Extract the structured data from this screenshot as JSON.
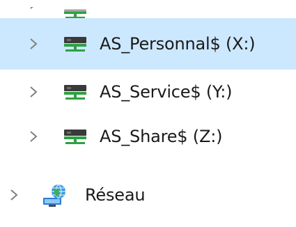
{
  "tree": {
    "items": [
      {
        "label": "",
        "icon": "network-drive-icon",
        "expanded": false,
        "selected": false
      },
      {
        "label": "AS_Personnal$ (X:)",
        "icon": "network-drive-icon",
        "expanded": false,
        "selected": true
      },
      {
        "label": "AS_Service$ (Y:)",
        "icon": "network-drive-icon",
        "expanded": false,
        "selected": false
      },
      {
        "label": "AS_Share$ (Z:)",
        "icon": "network-drive-icon",
        "expanded": false,
        "selected": false
      },
      {
        "label": "Réseau",
        "icon": "network-globe-icon",
        "expanded": false,
        "selected": false
      }
    ]
  },
  "colors": {
    "selection": "#cce8ff",
    "drive_green": "#2ea043",
    "drive_dark": "#3a3a3a",
    "chevron": "#808080"
  }
}
